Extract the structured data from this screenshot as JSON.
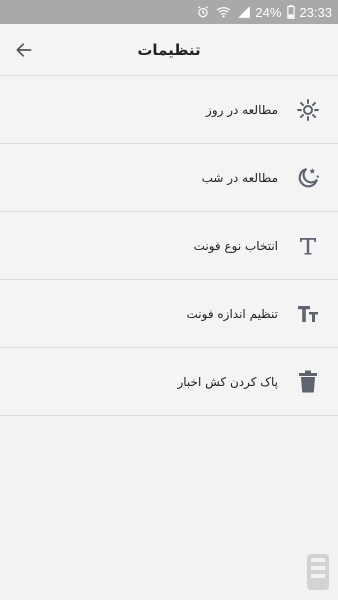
{
  "status_bar": {
    "battery": "24%",
    "time": "23:33",
    "icons": [
      "alarm-icon",
      "wifi-icon",
      "signal-icon",
      "battery-icon"
    ]
  },
  "app_bar": {
    "title": "تنظیمات",
    "back_icon": "arrow-left-icon"
  },
  "settings": {
    "items": [
      {
        "label": "مطالعه در روز",
        "icon": "sun-brightness-icon"
      },
      {
        "label": "مطالعه در شب",
        "icon": "moon-stars-icon"
      },
      {
        "label": "انتخاب نوع فونت",
        "icon": "serif-t-icon"
      },
      {
        "label": "تنظیم اندازه فونت",
        "icon": "text-size-icon"
      },
      {
        "label": "پاک کردن کش اخبار",
        "icon": "trash-icon"
      }
    ]
  },
  "colors": {
    "status_bar": "#a9a9a9",
    "background": "#f2f2f2",
    "icon": "#5f6470"
  }
}
